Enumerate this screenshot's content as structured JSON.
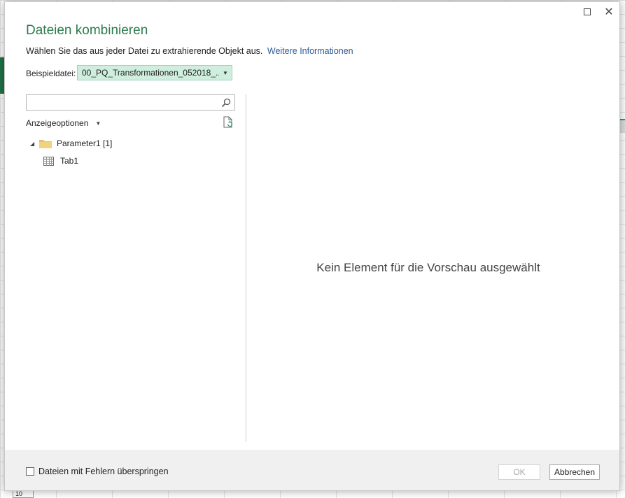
{
  "dialog": {
    "title": "Dateien kombinieren",
    "subtitle": "Wählen Sie das aus jeder Datei zu extrahierende Objekt aus.",
    "more_info_link": "Weitere Informationen",
    "sample_label": "Beispieldatei:",
    "sample_value": "00_PQ_Transformationen_052018_...",
    "search_placeholder": "",
    "display_options_label": "Anzeigeoptionen",
    "tree": [
      {
        "label": "Parameter1 [1]",
        "icon": "folder-icon",
        "expanded": true
      },
      {
        "label": "Tab1",
        "icon": "table-icon"
      }
    ],
    "preview_empty_text": "Kein Element für die Vorschau ausgewählt",
    "skip_errors_label": "Dateien mit Fehlern überspringen",
    "skip_errors_checked": false,
    "ok_label": "OK",
    "ok_enabled": false,
    "cancel_label": "Abbrechen"
  },
  "background": {
    "cell_value": "10"
  },
  "colors": {
    "title": "#2c7a4b",
    "link": "#2f5b96",
    "sample_bg": "#cfeedd",
    "footer_bg": "#f0f0f0"
  }
}
